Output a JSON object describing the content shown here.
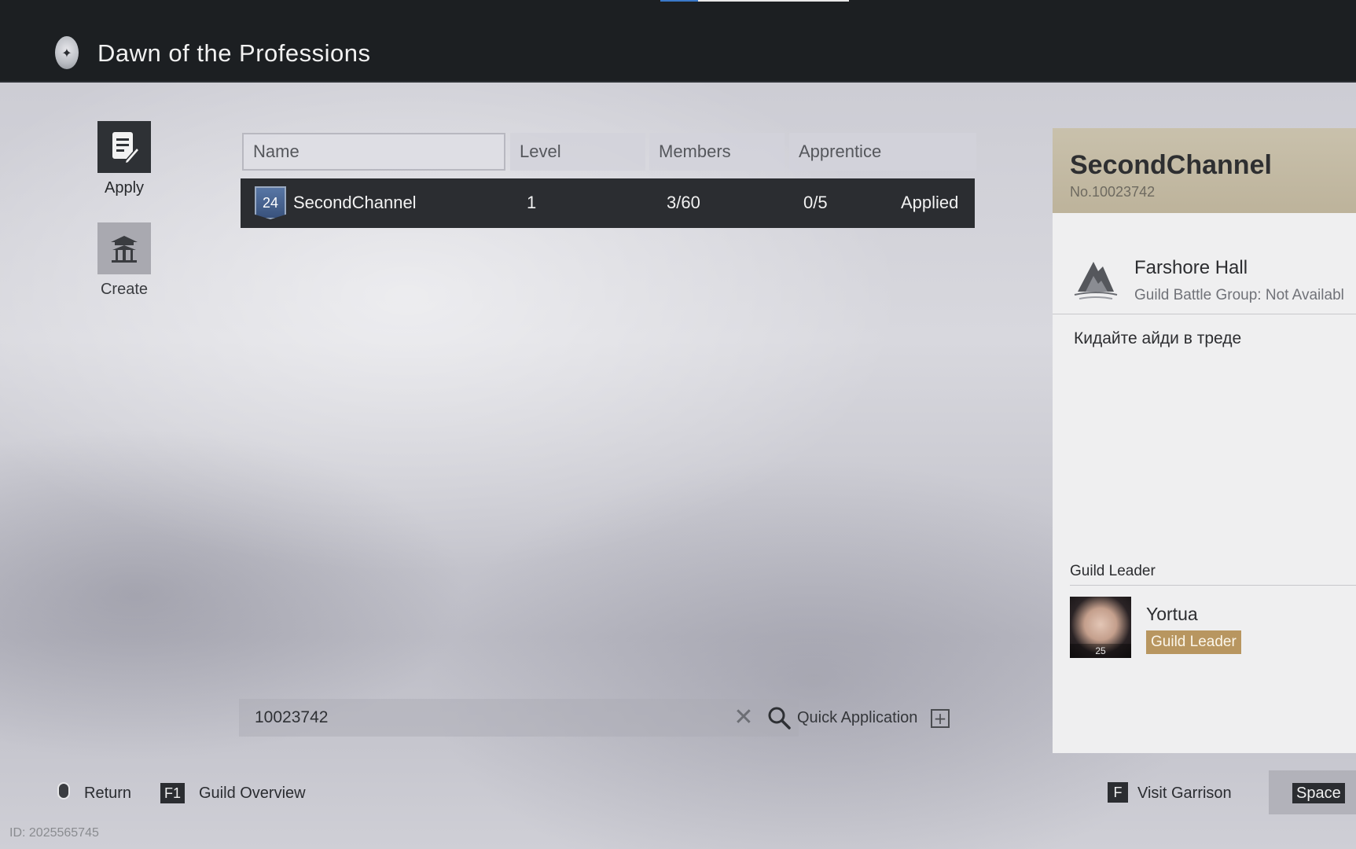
{
  "header": {
    "title": "Dawn of the Professions",
    "logo_icon": "emblem-icon"
  },
  "sidebar": {
    "items": [
      {
        "label": "Apply",
        "icon": "apply-document-icon",
        "active": true
      },
      {
        "label": "Create",
        "icon": "pavilion-icon",
        "active": false
      }
    ]
  },
  "table": {
    "columns": [
      "Name",
      "Level",
      "Members",
      "Apprentice"
    ],
    "rows": [
      {
        "badge": "24",
        "name": "SecondChannel",
        "level": "1",
        "members": "3/60",
        "apprentice": "0/5",
        "status": "Applied"
      }
    ]
  },
  "search": {
    "value": "10023742",
    "quick_application_label": "Quick Application"
  },
  "detail": {
    "guild_name": "SecondChannel",
    "guild_no": "No.10023742",
    "hall_name": "Farshore Hall",
    "battle_group": "Guild Battle Group: Not Availabl",
    "notice": "Кидайте айди в треде",
    "leader_heading": "Guild Leader",
    "leader": {
      "name": "Yortua",
      "level": "25",
      "role": "Guild Leader"
    }
  },
  "footer": {
    "return_label": "Return",
    "overview_key": "F1",
    "overview_label": "Guild Overview",
    "garrison_key": "F",
    "garrison_label": "Visit Garrison",
    "space_key": "Space",
    "player_id": "ID: 2025565745"
  },
  "colors": {
    "header_bg": "#1c1f22",
    "row_selected_bg": "#2b2d31",
    "detail_header_bg": "#c9c1ac",
    "leader_badge_bg": "#b89660",
    "tab_accent": "#3a78c8"
  }
}
